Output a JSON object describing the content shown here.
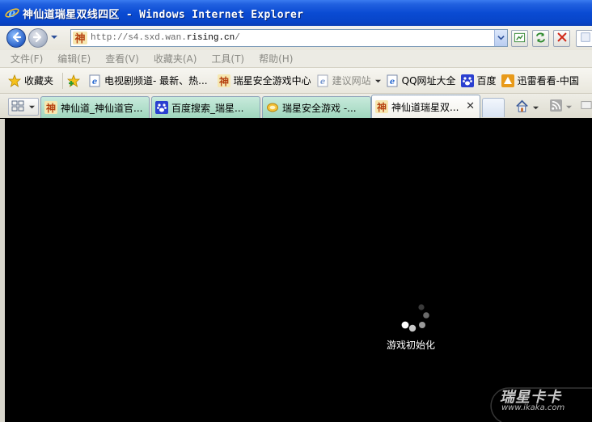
{
  "window": {
    "title": "神仙道瑞星双线四区 - Windows Internet Explorer"
  },
  "address_bar": {
    "url_prefix": "http://s4.sxd.wan.",
    "url_domain": "rising.cn",
    "url_suffix": "/"
  },
  "menu": {
    "items": [
      "文件(F)",
      "编辑(E)",
      "查看(V)",
      "收藏夹(A)",
      "工具(T)",
      "帮助(H)"
    ]
  },
  "favorites": {
    "label": "收藏夹",
    "items": [
      {
        "label": "电视剧频道- 最新、热...",
        "icon": "ie-page-icon"
      },
      {
        "label": "瑞星安全游戏中心",
        "icon": "shen-logo-icon"
      },
      {
        "label": "建议网站",
        "icon": "ie-page-icon"
      },
      {
        "label": "QQ网址大全",
        "icon": "ie-page-icon"
      },
      {
        "label": "百度",
        "icon": "baidu-paw-icon"
      },
      {
        "label": "迅雷看看-中国",
        "icon": "xunlei-icon"
      }
    ]
  },
  "tabs": [
    {
      "label": "神仙道_神仙道官...",
      "icon": "shen-logo-icon",
      "active": false
    },
    {
      "label": "百度搜索_瑞星...",
      "icon": "baidu-paw-icon",
      "active": false
    },
    {
      "label": "瑞星安全游戏 -...",
      "icon": "rising-chat-icon",
      "active": false
    },
    {
      "label": "神仙道瑞星双...",
      "icon": "shen-logo-icon",
      "active": true
    }
  ],
  "content": {
    "loading_text": "游戏初始化"
  },
  "watermark": {
    "title": "瑞星卡卡",
    "url": "www.ikaka.com"
  },
  "colors": {
    "titlebar": "#0a4bd3",
    "tab_inactive": "#b3e0cc",
    "content_bg": "#000000"
  }
}
